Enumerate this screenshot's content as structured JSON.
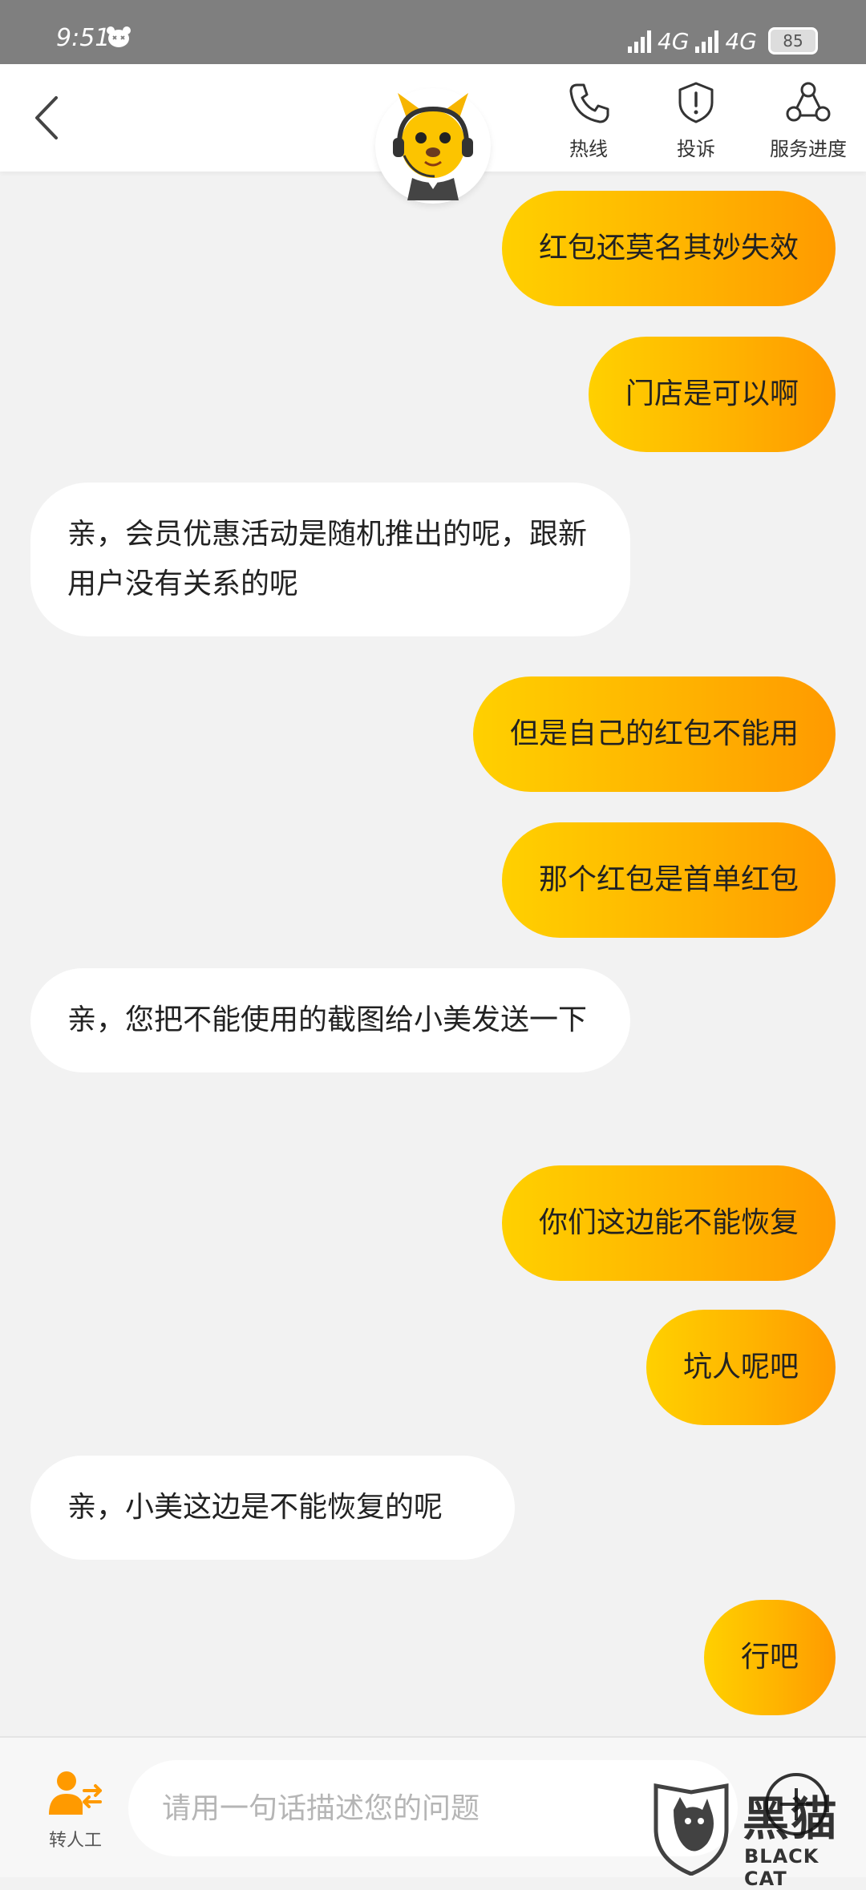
{
  "status_bar": {
    "time": "9:51",
    "network_1": "4G",
    "network_2": "4G",
    "battery": "85"
  },
  "header": {
    "hotline_label": "热线",
    "complaint_label": "投诉",
    "progress_label": "服务进度"
  },
  "messages": [
    {
      "side": "out",
      "text": "红包还莫名其妙失效"
    },
    {
      "side": "out",
      "text": "门店是可以啊"
    },
    {
      "side": "in",
      "text": "亲，会员优惠活动是随机推出的呢，跟新用户没有关系的呢"
    },
    {
      "side": "out",
      "text": "但是自己的红包不能用"
    },
    {
      "side": "out",
      "text": "那个红包是首单红包"
    },
    {
      "side": "in",
      "text": "亲，您把不能使用的截图给小美发送一下"
    },
    {
      "side": "out",
      "text": "你们这边能不能恢复"
    },
    {
      "side": "out",
      "text": "坑人呢吧"
    },
    {
      "side": "in",
      "text": "亲，小美这边是不能恢复的呢"
    },
    {
      "side": "out",
      "text": "行吧"
    }
  ],
  "bottom_bar": {
    "human_label": "转人工",
    "input_placeholder": "请用一句话描述您的问题",
    "input_value": ""
  },
  "watermark": {
    "text_cn": "黑猫",
    "text_en": "BLACK CAT"
  },
  "colors": {
    "accent_start": "#ffd000",
    "accent_end": "#ff9a00",
    "icon_orange": "#ff9a00"
  }
}
